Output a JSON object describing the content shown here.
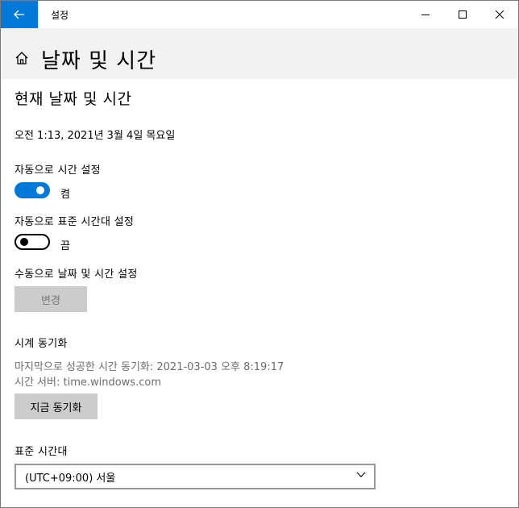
{
  "window": {
    "title": "설정"
  },
  "header": {
    "title": "날짜 및 시간"
  },
  "section": {
    "title": "현재 날짜 및 시간",
    "current_datetime": "오전 1:13, 2021년 3월 4일 목요일"
  },
  "auto_time": {
    "label": "자동으로 시간 설정",
    "state": "켬",
    "enabled": true
  },
  "auto_timezone": {
    "label": "자동으로 표준 시간대 설정",
    "state": "끔",
    "enabled": false
  },
  "manual": {
    "label": "수동으로 날짜 및 시간 설정",
    "button": "변경"
  },
  "sync": {
    "label": "시계 동기화",
    "last_sync": "마지막으로 성공한 시간 동기화: 2021-03-03 오후 8:19:17",
    "server": "시간 서버: time.windows.com",
    "button": "지금 동기화"
  },
  "timezone": {
    "label": "표준 시간대",
    "selected": "(UTC+09:00) 서울"
  },
  "colors": {
    "accent": "#0078d7",
    "header_bg": "#f2f2f2",
    "button_bg": "#cccccc"
  }
}
